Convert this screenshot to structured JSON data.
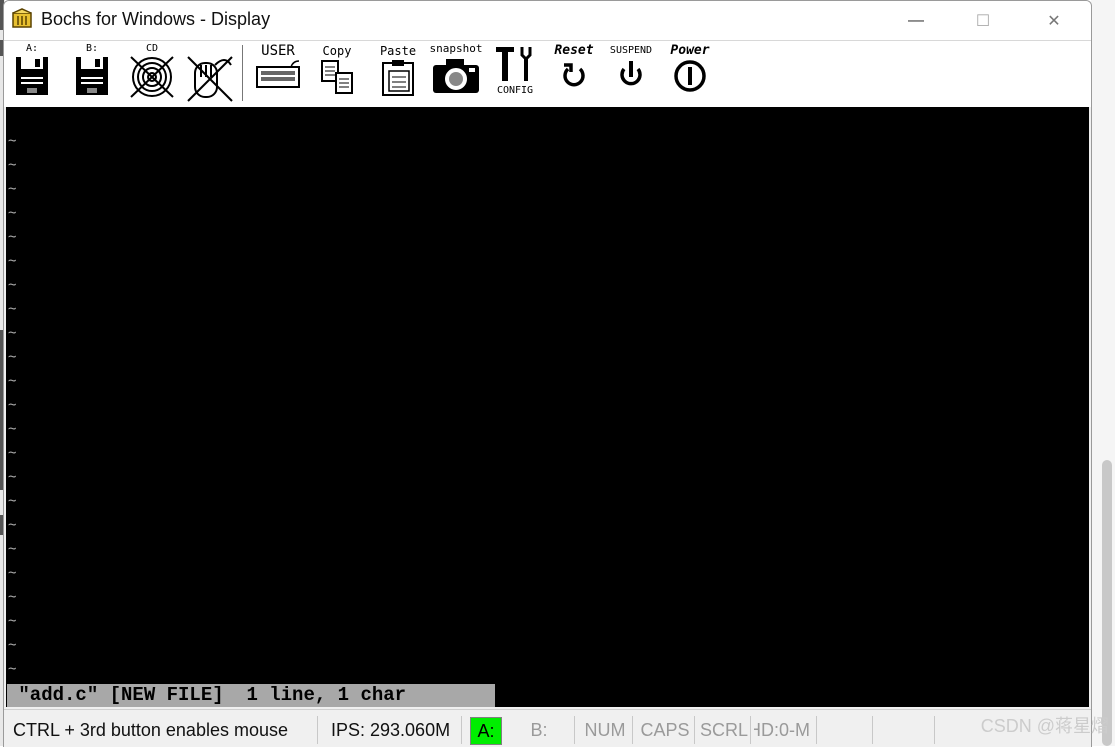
{
  "window": {
    "title": "Bochs for Windows - Display",
    "controls": {
      "minimize": "—",
      "maximize": "☐",
      "close": "✕"
    }
  },
  "toolbar": {
    "floppy_a": "A:",
    "floppy_b": "B:",
    "cdrom": "CD",
    "mouse": "",
    "user": "USER",
    "copy": "Copy",
    "paste": "Paste",
    "snapshot": "snapshot",
    "config": "CONFIG",
    "reset": "Reset",
    "suspend": "SUSPEND",
    "power": "Power"
  },
  "screen": {
    "tilde_char": "~",
    "tilde_count": 23,
    "status_line": " \"add.c\" [NEW FILE]  1 line, 1 char "
  },
  "statusbar": {
    "mouse_hint": "CTRL + 3rd button enables mouse",
    "ips": "IPS: 293.060M",
    "drive_a": "A:",
    "drive_b": "B:",
    "num": "NUM",
    "caps": "CAPS",
    "scrl": "SCRL",
    "hd": "HD:0-M"
  },
  "watermark": "CSDN @蒋星熠",
  "colors": {
    "active_drive": "#00ee00",
    "screen_bg": "#000000",
    "vim_status_bg": "#a8a8a8"
  }
}
